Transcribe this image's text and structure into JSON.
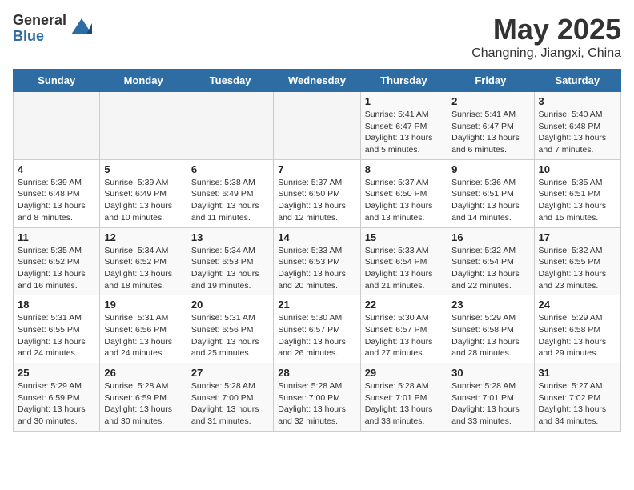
{
  "header": {
    "logo_general": "General",
    "logo_blue": "Blue",
    "title": "May 2025",
    "location": "Changning, Jiangxi, China"
  },
  "weekdays": [
    "Sunday",
    "Monday",
    "Tuesday",
    "Wednesday",
    "Thursday",
    "Friday",
    "Saturday"
  ],
  "weeks": [
    [
      {
        "day": "",
        "info": ""
      },
      {
        "day": "",
        "info": ""
      },
      {
        "day": "",
        "info": ""
      },
      {
        "day": "",
        "info": ""
      },
      {
        "day": "1",
        "info": "Sunrise: 5:41 AM\nSunset: 6:47 PM\nDaylight: 13 hours\nand 5 minutes."
      },
      {
        "day": "2",
        "info": "Sunrise: 5:41 AM\nSunset: 6:47 PM\nDaylight: 13 hours\nand 6 minutes."
      },
      {
        "day": "3",
        "info": "Sunrise: 5:40 AM\nSunset: 6:48 PM\nDaylight: 13 hours\nand 7 minutes."
      }
    ],
    [
      {
        "day": "4",
        "info": "Sunrise: 5:39 AM\nSunset: 6:48 PM\nDaylight: 13 hours\nand 8 minutes."
      },
      {
        "day": "5",
        "info": "Sunrise: 5:39 AM\nSunset: 6:49 PM\nDaylight: 13 hours\nand 10 minutes."
      },
      {
        "day": "6",
        "info": "Sunrise: 5:38 AM\nSunset: 6:49 PM\nDaylight: 13 hours\nand 11 minutes."
      },
      {
        "day": "7",
        "info": "Sunrise: 5:37 AM\nSunset: 6:50 PM\nDaylight: 13 hours\nand 12 minutes."
      },
      {
        "day": "8",
        "info": "Sunrise: 5:37 AM\nSunset: 6:50 PM\nDaylight: 13 hours\nand 13 minutes."
      },
      {
        "day": "9",
        "info": "Sunrise: 5:36 AM\nSunset: 6:51 PM\nDaylight: 13 hours\nand 14 minutes."
      },
      {
        "day": "10",
        "info": "Sunrise: 5:35 AM\nSunset: 6:51 PM\nDaylight: 13 hours\nand 15 minutes."
      }
    ],
    [
      {
        "day": "11",
        "info": "Sunrise: 5:35 AM\nSunset: 6:52 PM\nDaylight: 13 hours\nand 16 minutes."
      },
      {
        "day": "12",
        "info": "Sunrise: 5:34 AM\nSunset: 6:52 PM\nDaylight: 13 hours\nand 18 minutes."
      },
      {
        "day": "13",
        "info": "Sunrise: 5:34 AM\nSunset: 6:53 PM\nDaylight: 13 hours\nand 19 minutes."
      },
      {
        "day": "14",
        "info": "Sunrise: 5:33 AM\nSunset: 6:53 PM\nDaylight: 13 hours\nand 20 minutes."
      },
      {
        "day": "15",
        "info": "Sunrise: 5:33 AM\nSunset: 6:54 PM\nDaylight: 13 hours\nand 21 minutes."
      },
      {
        "day": "16",
        "info": "Sunrise: 5:32 AM\nSunset: 6:54 PM\nDaylight: 13 hours\nand 22 minutes."
      },
      {
        "day": "17",
        "info": "Sunrise: 5:32 AM\nSunset: 6:55 PM\nDaylight: 13 hours\nand 23 minutes."
      }
    ],
    [
      {
        "day": "18",
        "info": "Sunrise: 5:31 AM\nSunset: 6:55 PM\nDaylight: 13 hours\nand 24 minutes."
      },
      {
        "day": "19",
        "info": "Sunrise: 5:31 AM\nSunset: 6:56 PM\nDaylight: 13 hours\nand 24 minutes."
      },
      {
        "day": "20",
        "info": "Sunrise: 5:31 AM\nSunset: 6:56 PM\nDaylight: 13 hours\nand 25 minutes."
      },
      {
        "day": "21",
        "info": "Sunrise: 5:30 AM\nSunset: 6:57 PM\nDaylight: 13 hours\nand 26 minutes."
      },
      {
        "day": "22",
        "info": "Sunrise: 5:30 AM\nSunset: 6:57 PM\nDaylight: 13 hours\nand 27 minutes."
      },
      {
        "day": "23",
        "info": "Sunrise: 5:29 AM\nSunset: 6:58 PM\nDaylight: 13 hours\nand 28 minutes."
      },
      {
        "day": "24",
        "info": "Sunrise: 5:29 AM\nSunset: 6:58 PM\nDaylight: 13 hours\nand 29 minutes."
      }
    ],
    [
      {
        "day": "25",
        "info": "Sunrise: 5:29 AM\nSunset: 6:59 PM\nDaylight: 13 hours\nand 30 minutes."
      },
      {
        "day": "26",
        "info": "Sunrise: 5:28 AM\nSunset: 6:59 PM\nDaylight: 13 hours\nand 30 minutes."
      },
      {
        "day": "27",
        "info": "Sunrise: 5:28 AM\nSunset: 7:00 PM\nDaylight: 13 hours\nand 31 minutes."
      },
      {
        "day": "28",
        "info": "Sunrise: 5:28 AM\nSunset: 7:00 PM\nDaylight: 13 hours\nand 32 minutes."
      },
      {
        "day": "29",
        "info": "Sunrise: 5:28 AM\nSunset: 7:01 PM\nDaylight: 13 hours\nand 33 minutes."
      },
      {
        "day": "30",
        "info": "Sunrise: 5:28 AM\nSunset: 7:01 PM\nDaylight: 13 hours\nand 33 minutes."
      },
      {
        "day": "31",
        "info": "Sunrise: 5:27 AM\nSunset: 7:02 PM\nDaylight: 13 hours\nand 34 minutes."
      }
    ]
  ]
}
